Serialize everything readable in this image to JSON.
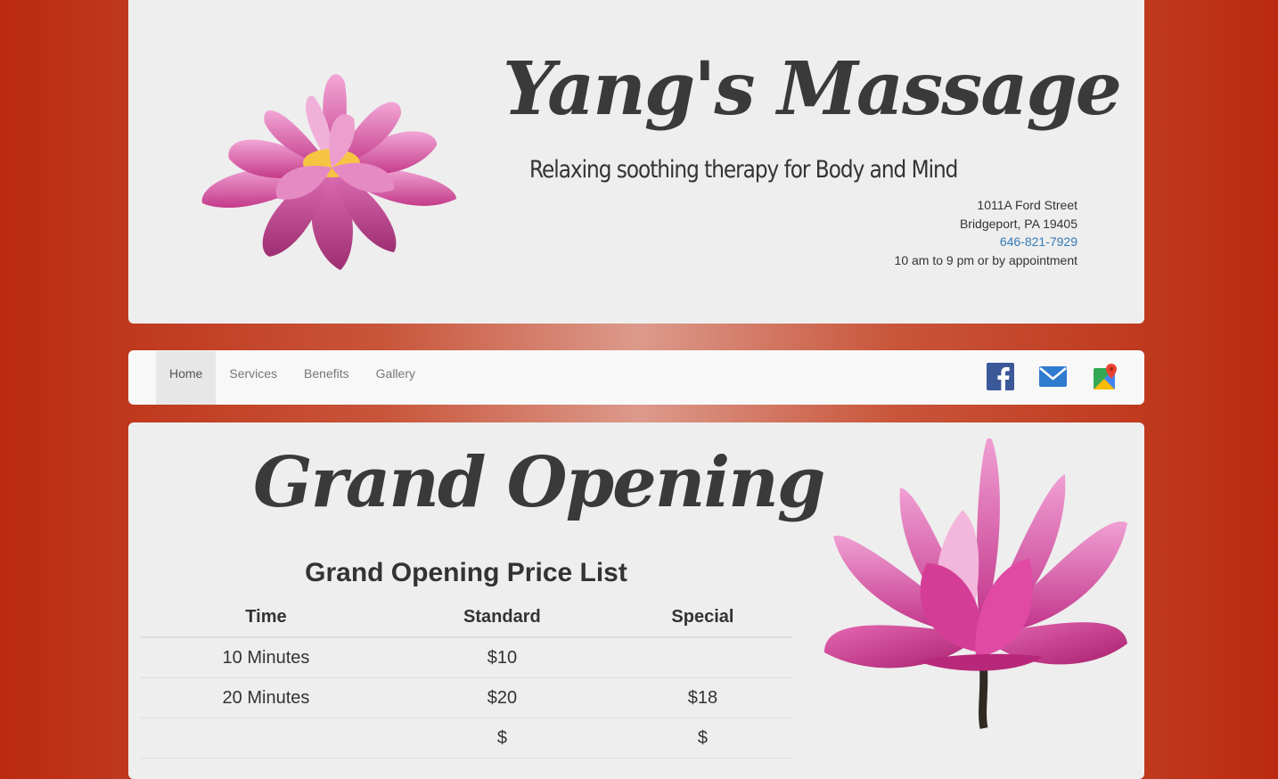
{
  "header": {
    "title": "Yang's Massage",
    "tagline": "Relaxing soothing therapy for Body and Mind",
    "address_line1": "1011A Ford Street",
    "address_line2": "Bridgeport, PA 19405",
    "phone": "646-821-7929",
    "hours": "10 am to 9 pm or by appointment"
  },
  "nav": {
    "items": [
      {
        "label": "Home",
        "active": true
      },
      {
        "label": "Services"
      },
      {
        "label": "Benefits"
      },
      {
        "label": "Gallery"
      }
    ],
    "social": [
      "facebook-icon",
      "email-icon",
      "google-maps-icon"
    ]
  },
  "main": {
    "title": "Grand Opening",
    "price_heading": "Grand Opening Price List",
    "table": {
      "headers": [
        "Time",
        "Standard",
        "Special"
      ],
      "rows": [
        [
          "10 Minutes",
          "$10",
          ""
        ],
        [
          "20 Minutes",
          "$20",
          "$18"
        ],
        [
          "",
          "$",
          "$"
        ]
      ]
    }
  },
  "colors": {
    "background": "#bb2a10",
    "panel": "#eeeeee",
    "link": "#337ab7",
    "lotus_pink": "#d9489a"
  }
}
